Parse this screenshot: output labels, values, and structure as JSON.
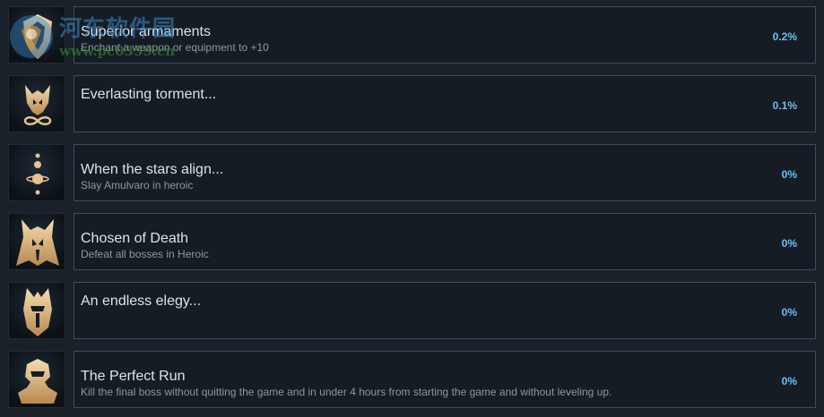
{
  "achievements": [
    {
      "title": "Superior armaments",
      "description": "Enchant a weapon or equipment to +10",
      "percent": "0.2%",
      "icon": "shield-emblem-icon"
    },
    {
      "title": "Everlasting torment...",
      "description": "",
      "percent": "0.1%",
      "icon": "horned-mask-infinity-icon"
    },
    {
      "title": "When the stars align...",
      "description": "Slay Amulvaro in heroic",
      "percent": "0%",
      "icon": "aligned-stars-icon"
    },
    {
      "title": "Chosen of Death",
      "description": "Defeat all bosses in Heroic",
      "percent": "0%",
      "icon": "horned-helmet-icon"
    },
    {
      "title": "An endless elegy...",
      "description": "",
      "percent": "0%",
      "icon": "winged-helmet-icon"
    },
    {
      "title": "The Perfect Run",
      "description": "Kill the final boss without quitting the game and in under 4 hours from starting the game and without leveling up.",
      "percent": "0%",
      "icon": "armored-helm-icon"
    }
  ],
  "watermark": {
    "name": "河东软件园",
    "url": "www.pc0359.cn",
    "logo": "hedong-logo-icon"
  },
  "colors": {
    "background": "#1b2129",
    "card": "#161c24",
    "card_border": "#3b4d5e",
    "title": "#dfe3e6",
    "description": "#8e969e",
    "percent": "#66c0f4",
    "icon_gold": "#e6c291"
  }
}
